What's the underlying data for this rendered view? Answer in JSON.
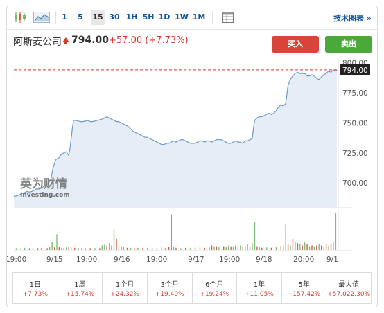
{
  "toolbar": {
    "intervals": [
      {
        "label": "1",
        "selected": false
      },
      {
        "label": "5",
        "selected": false
      },
      {
        "label": "15",
        "selected": true
      },
      {
        "label": "30",
        "selected": false
      },
      {
        "label": "1H",
        "selected": false
      },
      {
        "label": "5H",
        "selected": false
      },
      {
        "label": "1D",
        "selected": false
      },
      {
        "label": "1W",
        "selected": false
      },
      {
        "label": "1M",
        "selected": false
      }
    ],
    "technical_link": "技术图表 »"
  },
  "header": {
    "name": "阿斯麦公司",
    "price": "794.00",
    "change": "+57.00 (+7.73%)",
    "buy_label": "买入",
    "sell_label": "卖出"
  },
  "colors": {
    "up": "#d9372b",
    "down": "#4ba83b",
    "line": "#6b9ac9",
    "area": "#e6edf6"
  },
  "watermark": {
    "cn": "英为财情",
    "en": "Investing.com"
  },
  "chart_data": {
    "type": "area",
    "y_ticks": [
      "800.00",
      "775.00",
      "750.00",
      "725.00",
      "700.00"
    ],
    "ylim": [
      680,
      802
    ],
    "last_price_label": "794.00",
    "last_price": 794.0,
    "x_tick_labels": [
      "19:00",
      "9/15",
      "19:00",
      "9/16",
      "19:00",
      "9/17",
      "19:00",
      "9/18",
      "20:00",
      "9/1"
    ],
    "price_series": [
      [
        0,
        689
      ],
      [
        3,
        689.5
      ],
      [
        6,
        691
      ],
      [
        9,
        692
      ],
      [
        11,
        693
      ],
      [
        13,
        692.5
      ],
      [
        15,
        693
      ],
      [
        17,
        694
      ],
      [
        19,
        695
      ],
      [
        21,
        695
      ],
      [
        23,
        696
      ],
      [
        25,
        697
      ],
      [
        27,
        698
      ],
      [
        29,
        700
      ],
      [
        31,
        703
      ],
      [
        32,
        708
      ],
      [
        33,
        713
      ],
      [
        34,
        716
      ],
      [
        35,
        719
      ],
      [
        36,
        720
      ],
      [
        38,
        721
      ],
      [
        40,
        724
      ],
      [
        42,
        725
      ],
      [
        44,
        726
      ],
      [
        46,
        723
      ],
      [
        47,
        728
      ],
      [
        48,
        736
      ],
      [
        49,
        745
      ],
      [
        50,
        752
      ],
      [
        52,
        752
      ],
      [
        54,
        751.5
      ],
      [
        56,
        751
      ],
      [
        58,
        751
      ],
      [
        60,
        751.5
      ],
      [
        62,
        752
      ],
      [
        64,
        751
      ],
      [
        66,
        751
      ],
      [
        68,
        751.5
      ],
      [
        70,
        752
      ],
      [
        72,
        752.5
      ],
      [
        74,
        753
      ],
      [
        76,
        754
      ],
      [
        78,
        755
      ],
      [
        80,
        754
      ],
      [
        82,
        753
      ],
      [
        84,
        752
      ],
      [
        86,
        751
      ],
      [
        88,
        751
      ],
      [
        90,
        750
      ],
      [
        92,
        749
      ],
      [
        94,
        748
      ],
      [
        96,
        747
      ],
      [
        98,
        745
      ],
      [
        100,
        743
      ],
      [
        102,
        742
      ],
      [
        104,
        741
      ],
      [
        106,
        740
      ],
      [
        108,
        739
      ],
      [
        110,
        738
      ],
      [
        112,
        738
      ],
      [
        114,
        737
      ],
      [
        116,
        736
      ],
      [
        118,
        735
      ],
      [
        120,
        734
      ],
      [
        122,
        733
      ],
      [
        124,
        732
      ],
      [
        126,
        732
      ],
      [
        128,
        733
      ],
      [
        130,
        733
      ],
      [
        132,
        734
      ],
      [
        134,
        735
      ],
      [
        136,
        734
      ],
      [
        138,
        735
      ],
      [
        140,
        736
      ],
      [
        142,
        736
      ],
      [
        144,
        735
      ],
      [
        146,
        734
      ],
      [
        148,
        733
      ],
      [
        150,
        733
      ],
      [
        152,
        733
      ],
      [
        154,
        734
      ],
      [
        156,
        735
      ],
      [
        158,
        735
      ],
      [
        160,
        734
      ],
      [
        162,
        735
      ],
      [
        164,
        735
      ],
      [
        166,
        734
      ],
      [
        168,
        735
      ],
      [
        170,
        736
      ],
      [
        172,
        736
      ],
      [
        174,
        736
      ],
      [
        176,
        735
      ],
      [
        178,
        734
      ],
      [
        180,
        733
      ],
      [
        182,
        733
      ],
      [
        184,
        734
      ],
      [
        186,
        735
      ],
      [
        188,
        734
      ],
      [
        190,
        734
      ],
      [
        192,
        733
      ],
      [
        194,
        735
      ],
      [
        196,
        735
      ],
      [
        198,
        736
      ],
      [
        200,
        737
      ],
      [
        201,
        745
      ],
      [
        202,
        752
      ],
      [
        204,
        754
      ],
      [
        206,
        755
      ],
      [
        208,
        755
      ],
      [
        210,
        756
      ],
      [
        212,
        757
      ],
      [
        214,
        758
      ],
      [
        216,
        757
      ],
      [
        218,
        758
      ],
      [
        220,
        760
      ],
      [
        222,
        763
      ],
      [
        224,
        765
      ],
      [
        226,
        764
      ],
      [
        228,
        766
      ],
      [
        229,
        773
      ],
      [
        230,
        781
      ],
      [
        232,
        786
      ],
      [
        234,
        789
      ],
      [
        236,
        791
      ],
      [
        238,
        792
      ],
      [
        240,
        791
      ],
      [
        242,
        791
      ],
      [
        244,
        791
      ],
      [
        246,
        789
      ],
      [
        248,
        789
      ],
      [
        250,
        790
      ],
      [
        252,
        789
      ],
      [
        254,
        787
      ],
      [
        256,
        786
      ],
      [
        258,
        788
      ],
      [
        260,
        790
      ],
      [
        262,
        791
      ],
      [
        264,
        793
      ],
      [
        266,
        792
      ],
      [
        268,
        794
      ],
      [
        270,
        793
      ],
      [
        271,
        794
      ]
    ],
    "volume_series": [
      [
        2,
        0.05,
        "up"
      ],
      [
        6,
        0.05,
        "down"
      ],
      [
        9,
        0.06,
        "up"
      ],
      [
        13,
        0.05,
        "down"
      ],
      [
        16,
        0.06,
        "up"
      ],
      [
        20,
        0.05,
        "down"
      ],
      [
        23,
        0.06,
        "up"
      ],
      [
        28,
        0.05,
        "down"
      ],
      [
        30,
        0.08,
        "up"
      ],
      [
        32,
        0.22,
        "up"
      ],
      [
        34,
        0.07,
        "down"
      ],
      [
        36,
        0.42,
        "up"
      ],
      [
        38,
        0.08,
        "down"
      ],
      [
        40,
        0.06,
        "up"
      ],
      [
        42,
        0.06,
        "down"
      ],
      [
        44,
        0.08,
        "up"
      ],
      [
        46,
        0.07,
        "down"
      ],
      [
        48,
        0.07,
        "up"
      ],
      [
        51,
        0.06,
        "down"
      ],
      [
        54,
        0.05,
        "up"
      ],
      [
        57,
        0.06,
        "down"
      ],
      [
        60,
        0.05,
        "up"
      ],
      [
        64,
        0.05,
        "down"
      ],
      [
        68,
        0.05,
        "up"
      ],
      [
        72,
        0.05,
        "down"
      ],
      [
        74,
        0.12,
        "up"
      ],
      [
        76,
        0.14,
        "up"
      ],
      [
        78,
        0.12,
        "down"
      ],
      [
        80,
        0.18,
        "up"
      ],
      [
        82,
        0.12,
        "down"
      ],
      [
        84,
        0.55,
        "up"
      ],
      [
        86,
        0.3,
        "down"
      ],
      [
        88,
        0.12,
        "up"
      ],
      [
        90,
        0.1,
        "down"
      ],
      [
        92,
        0.08,
        "up"
      ],
      [
        95,
        0.06,
        "down"
      ],
      [
        98,
        0.06,
        "up"
      ],
      [
        101,
        0.05,
        "down"
      ],
      [
        104,
        0.06,
        "up"
      ],
      [
        108,
        0.05,
        "down"
      ],
      [
        112,
        0.06,
        "up"
      ],
      [
        116,
        0.05,
        "down"
      ],
      [
        120,
        0.06,
        "up"
      ],
      [
        124,
        0.07,
        "down"
      ],
      [
        127,
        0.06,
        "up"
      ],
      [
        130,
        0.08,
        "down"
      ],
      [
        132,
        0.95,
        "down"
      ],
      [
        134,
        0.08,
        "up"
      ],
      [
        136,
        0.06,
        "down"
      ],
      [
        140,
        0.05,
        "up"
      ],
      [
        144,
        0.06,
        "down"
      ],
      [
        148,
        0.05,
        "up"
      ],
      [
        152,
        0.06,
        "down"
      ],
      [
        156,
        0.07,
        "up"
      ],
      [
        160,
        0.06,
        "down"
      ],
      [
        164,
        0.07,
        "up"
      ],
      [
        166,
        0.12,
        "down"
      ],
      [
        168,
        0.1,
        "up"
      ],
      [
        170,
        0.1,
        "down"
      ],
      [
        172,
        0.08,
        "up"
      ],
      [
        176,
        0.1,
        "down"
      ],
      [
        178,
        0.08,
        "up"
      ],
      [
        180,
        0.12,
        "up"
      ],
      [
        182,
        0.1,
        "down"
      ],
      [
        184,
        0.08,
        "up"
      ],
      [
        186,
        0.12,
        "down"
      ],
      [
        188,
        0.1,
        "up"
      ],
      [
        190,
        0.12,
        "up"
      ],
      [
        192,
        0.08,
        "down"
      ],
      [
        194,
        0.1,
        "up"
      ],
      [
        196,
        0.15,
        "up"
      ],
      [
        198,
        0.1,
        "down"
      ],
      [
        200,
        0.18,
        "up"
      ],
      [
        202,
        0.75,
        "up"
      ],
      [
        204,
        0.1,
        "down"
      ],
      [
        206,
        0.08,
        "up"
      ],
      [
        208,
        0.06,
        "down"
      ],
      [
        212,
        0.07,
        "up"
      ],
      [
        216,
        0.06,
        "down"
      ],
      [
        220,
        0.08,
        "up"
      ],
      [
        224,
        0.1,
        "down"
      ],
      [
        226,
        0.12,
        "up"
      ],
      [
        228,
        0.68,
        "up"
      ],
      [
        230,
        0.15,
        "down"
      ],
      [
        232,
        0.12,
        "up"
      ],
      [
        234,
        0.3,
        "down"
      ],
      [
        236,
        0.22,
        "up"
      ],
      [
        238,
        0.18,
        "down"
      ],
      [
        240,
        0.15,
        "up"
      ],
      [
        242,
        0.12,
        "down"
      ],
      [
        244,
        0.2,
        "up"
      ],
      [
        246,
        0.15,
        "down"
      ],
      [
        248,
        0.1,
        "up"
      ],
      [
        250,
        0.12,
        "down"
      ],
      [
        252,
        0.1,
        "up"
      ],
      [
        254,
        0.12,
        "down"
      ],
      [
        256,
        0.15,
        "up"
      ],
      [
        258,
        0.12,
        "down"
      ],
      [
        260,
        0.1,
        "up"
      ],
      [
        262,
        0.15,
        "down"
      ],
      [
        264,
        0.12,
        "up"
      ],
      [
        266,
        0.15,
        "down"
      ],
      [
        268,
        0.2,
        "up"
      ],
      [
        270,
        1.0,
        "up"
      ]
    ]
  },
  "periods": [
    {
      "label": "1日",
      "value": "+7.73%"
    },
    {
      "label": "1周",
      "value": "+15.74%"
    },
    {
      "label": "1个月",
      "value": "+24.32%"
    },
    {
      "label": "3个月",
      "value": "+19.40%"
    },
    {
      "label": "6个月",
      "value": "+19.24%"
    },
    {
      "label": "1年",
      "value": "+11.05%"
    },
    {
      "label": "5年",
      "value": "+157.42%"
    },
    {
      "label": "最大值",
      "value": "+57,022.30%"
    }
  ]
}
